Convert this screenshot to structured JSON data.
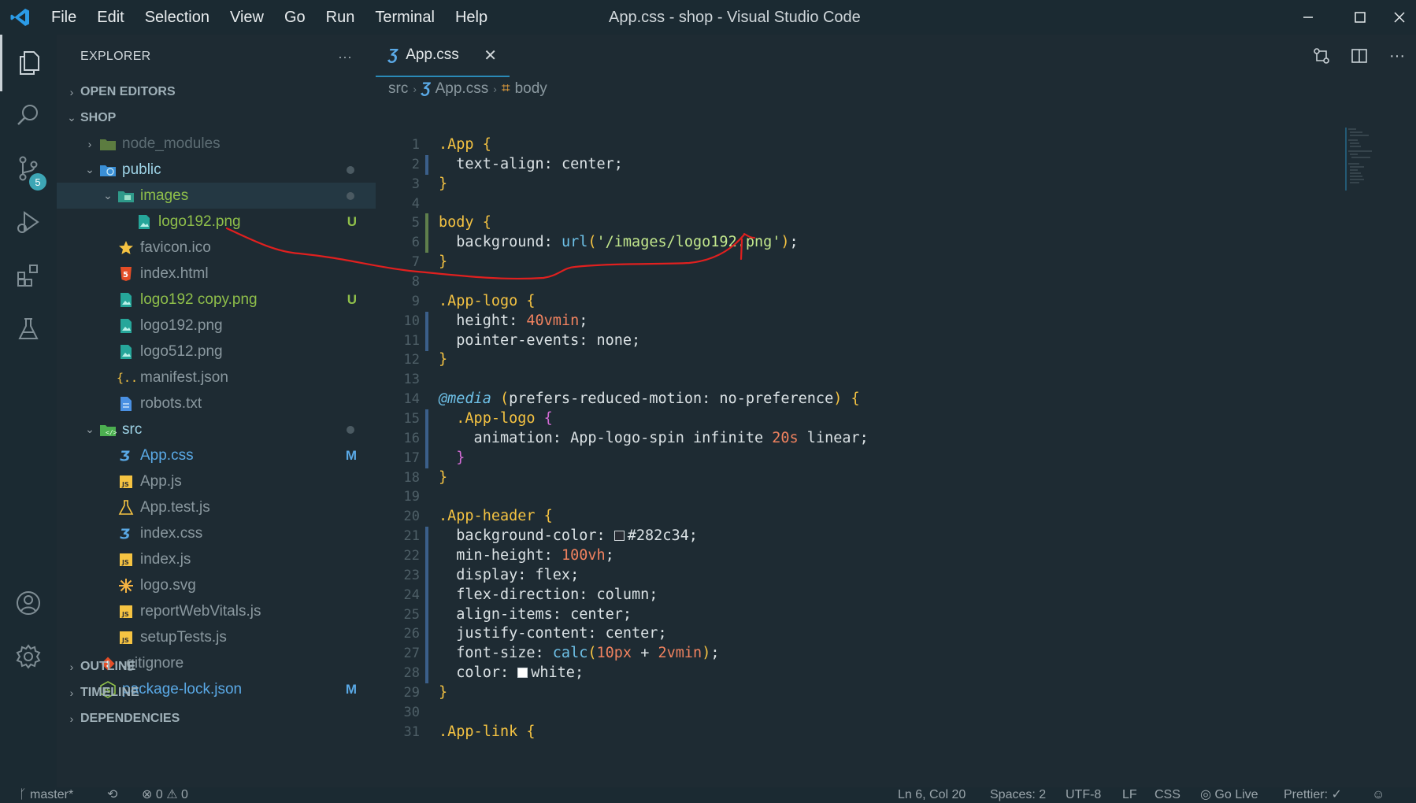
{
  "window": {
    "title": "App.css - shop - Visual Studio Code",
    "menu": [
      "File",
      "Edit",
      "Selection",
      "View",
      "Go",
      "Run",
      "Terminal",
      "Help"
    ]
  },
  "activity_bar": {
    "items": [
      "explorer-icon",
      "search-icon",
      "source-control-icon",
      "run-debug-icon",
      "extensions-icon",
      "testing-icon",
      "account-icon",
      "settings-gear-icon"
    ],
    "scm_badge": "5"
  },
  "sidebar": {
    "title": "EXPLORER",
    "more": "···",
    "sections": {
      "open_editors": "OPEN EDITORS",
      "project": "SHOP",
      "outline": "OUTLINE",
      "timeline": "TIMELINE",
      "dependencies": "DEPENDENCIES"
    },
    "tree": [
      {
        "label": "node_modules",
        "icon": "folder-node-icon",
        "color": "#5d6d74",
        "deco": ""
      },
      {
        "label": "public",
        "icon": "folder-public-icon",
        "color": "#9ed3e6",
        "deco": "dot"
      },
      {
        "label": "images",
        "icon": "folder-images-icon",
        "color": "#8fbf4a",
        "deco": "dot"
      },
      {
        "label": "logo192.png",
        "icon": "image-file-icon",
        "color": "#8fbf4a",
        "deco": "U"
      },
      {
        "label": "favicon.ico",
        "icon": "star-icon",
        "color": "#8a989f",
        "deco": ""
      },
      {
        "label": "index.html",
        "icon": "html-icon",
        "color": "#8a989f",
        "deco": ""
      },
      {
        "label": "logo192 copy.png",
        "icon": "image-file-icon",
        "color": "#8fbf4a",
        "deco": "U"
      },
      {
        "label": "logo192.png",
        "icon": "image-file-icon",
        "color": "#8a989f",
        "deco": ""
      },
      {
        "label": "logo512.png",
        "icon": "image-file-icon",
        "color": "#8a989f",
        "deco": ""
      },
      {
        "label": "manifest.json",
        "icon": "json-icon",
        "color": "#8a989f",
        "deco": ""
      },
      {
        "label": "robots.txt",
        "icon": "text-file-icon",
        "color": "#8a989f",
        "deco": ""
      },
      {
        "label": "src",
        "icon": "folder-src-icon",
        "color": "#9ed3e6",
        "deco": "dot"
      },
      {
        "label": "App.css",
        "icon": "css-icon",
        "color": "#5aa9e6",
        "deco": "M"
      },
      {
        "label": "App.js",
        "icon": "js-icon",
        "color": "#8a989f",
        "deco": ""
      },
      {
        "label": "App.test.js",
        "icon": "test-flask-icon",
        "color": "#8a989f",
        "deco": ""
      },
      {
        "label": "index.css",
        "icon": "css-icon",
        "color": "#8a989f",
        "deco": ""
      },
      {
        "label": "index.js",
        "icon": "js-icon",
        "color": "#8a989f",
        "deco": ""
      },
      {
        "label": "logo.svg",
        "icon": "svg-icon",
        "color": "#8a989f",
        "deco": ""
      },
      {
        "label": "reportWebVitals.js",
        "icon": "js-icon",
        "color": "#8a989f",
        "deco": ""
      },
      {
        "label": "setupTests.js",
        "icon": "js-icon",
        "color": "#8a989f",
        "deco": ""
      },
      {
        "label": ".gitignore",
        "icon": "git-icon",
        "color": "#8a989f",
        "deco": ""
      },
      {
        "label": "package-lock.json",
        "icon": "nodejs-icon",
        "color": "#5aa9e6",
        "deco": "M"
      }
    ],
    "deco_colors": {
      "U": "#8fbf4a",
      "M": "#5aa9e6"
    }
  },
  "editor": {
    "tab": {
      "label": "App.css",
      "close": "✕"
    },
    "breadcrumb": [
      "src",
      "App.css",
      "body"
    ],
    "active_line": 6,
    "code": [
      [
        {
          "t": ".App ",
          "c": "t-sel"
        },
        {
          "t": "{",
          "c": "t-br"
        }
      ],
      [
        {
          "t": "  text-align: "
        },
        {
          "t": "center"
        },
        {
          "t": ";"
        }
      ],
      [
        {
          "t": "}",
          "c": "t-br"
        }
      ],
      [],
      [
        {
          "t": "body ",
          "c": "t-sel"
        },
        {
          "t": "{",
          "c": "t-br"
        }
      ],
      [
        {
          "t": "  background: "
        },
        {
          "t": "url",
          "c": "t-fn"
        },
        {
          "t": "(",
          "c": "t-br"
        },
        {
          "t": "'/images/logo192.png'",
          "c": "t-str"
        },
        {
          "t": ")",
          "c": "t-br"
        },
        {
          "t": ";"
        }
      ],
      [
        {
          "t": "}",
          "c": "t-br"
        }
      ],
      [],
      [
        {
          "t": ".App-logo ",
          "c": "t-sel"
        },
        {
          "t": "{",
          "c": "t-br"
        }
      ],
      [
        {
          "t": "  height: "
        },
        {
          "t": "40vmin",
          "c": "t-num"
        },
        {
          "t": ";"
        }
      ],
      [
        {
          "t": "  pointer-events: "
        },
        {
          "t": "none"
        },
        {
          "t": ";"
        }
      ],
      [
        {
          "t": "}",
          "c": "t-br"
        }
      ],
      [],
      [
        {
          "t": "@media",
          "c": "t-at"
        },
        {
          "t": " "
        },
        {
          "t": "(",
          "c": "t-br"
        },
        {
          "t": "prefers-reduced-motion: no-preference"
        },
        {
          "t": ")",
          "c": "t-br"
        },
        {
          "t": " "
        },
        {
          "t": "{",
          "c": "t-br"
        }
      ],
      [
        {
          "t": "  .App-logo ",
          "c": "t-sel"
        },
        {
          "t": "{",
          "c": "t-br2"
        }
      ],
      [
        {
          "t": "    animation: App-logo-spin infinite "
        },
        {
          "t": "20s",
          "c": "t-num"
        },
        {
          "t": " linear;"
        }
      ],
      [
        {
          "t": "  }",
          "c": "t-br2"
        }
      ],
      [
        {
          "t": "}",
          "c": "t-br"
        }
      ],
      [],
      [
        {
          "t": ".App-header ",
          "c": "t-sel"
        },
        {
          "t": "{",
          "c": "t-br"
        }
      ],
      [
        {
          "t": "  background-color: "
        },
        {
          "swatch": "#282c34"
        },
        {
          "t": "#282c34;"
        }
      ],
      [
        {
          "t": "  min-height: "
        },
        {
          "t": "100vh",
          "c": "t-num"
        },
        {
          "t": ";"
        }
      ],
      [
        {
          "t": "  display: flex;"
        }
      ],
      [
        {
          "t": "  flex-direction: column;"
        }
      ],
      [
        {
          "t": "  align-items: center;"
        }
      ],
      [
        {
          "t": "  justify-content: center;"
        }
      ],
      [
        {
          "t": "  font-size: "
        },
        {
          "t": "calc",
          "c": "t-fn"
        },
        {
          "t": "(",
          "c": "t-br"
        },
        {
          "t": "10px",
          "c": "t-num"
        },
        {
          "t": " + "
        },
        {
          "t": "2vmin",
          "c": "t-num"
        },
        {
          "t": ")",
          "c": "t-br"
        },
        {
          "t": ";"
        }
      ],
      [
        {
          "t": "  color: "
        },
        {
          "swatch": "#ffffff"
        },
        {
          "t": "white;"
        }
      ],
      [
        {
          "t": "}",
          "c": "t-br"
        }
      ],
      [],
      [
        {
          "t": ".App-link ",
          "c": "t-sel"
        },
        {
          "t": "{",
          "c": "t-br"
        }
      ]
    ]
  },
  "status": {
    "branch": "master*",
    "sync": "⟲",
    "problems": "⊗ 0 ⚠ 0",
    "position": "Ln 6, Col 20",
    "spaces": "Spaces: 2",
    "encoding": "UTF-8",
    "eol": "LF",
    "language": "CSS",
    "go_live": "Go Live",
    "prettier": "Prettier: ✓"
  }
}
